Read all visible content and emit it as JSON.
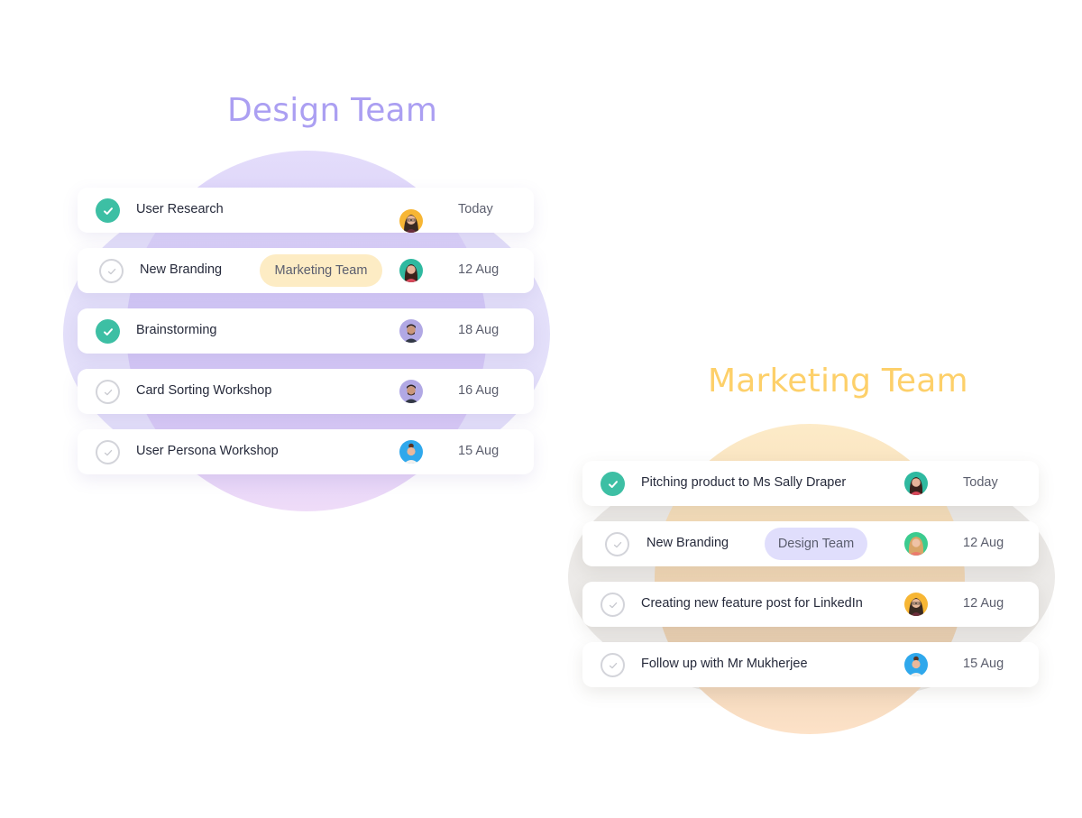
{
  "colors": {
    "design_accent": "#ab9ff2",
    "marketing_accent": "#fdd06a",
    "check_done": "#3dbfa4",
    "check_todo_border": "#d3d4da",
    "tag_marketing_bg": "#fdecc4",
    "tag_design_bg": "#e0defc"
  },
  "design_team": {
    "title": "Design Team",
    "tasks": [
      {
        "name": "User Research",
        "done": true,
        "tag": null,
        "avatar": "avatar-woman-glasses-yellow",
        "due": "Today"
      },
      {
        "name": "New Branding",
        "done": false,
        "tag": "Marketing Team",
        "avatar": "avatar-woman-teal",
        "due": "12 Aug"
      },
      {
        "name": "Brainstorming",
        "done": true,
        "tag": null,
        "avatar": "avatar-man-beard-lavender",
        "due": "18 Aug"
      },
      {
        "name": "Card Sorting Workshop",
        "done": false,
        "tag": null,
        "avatar": "avatar-man-beard-lavender",
        "due": "16 Aug"
      },
      {
        "name": "User Persona Workshop",
        "done": false,
        "tag": null,
        "avatar": "avatar-woman-blue",
        "due": "15 Aug"
      }
    ]
  },
  "marketing_team": {
    "title": "Marketing Team",
    "tasks": [
      {
        "name": "Pitching product to Ms Sally Draper",
        "done": true,
        "tag": null,
        "avatar": "avatar-woman-teal",
        "due": "Today"
      },
      {
        "name": "New Branding",
        "done": false,
        "tag": "Design Team",
        "avatar": "avatar-woman-blonde-green",
        "due": "12 Aug"
      },
      {
        "name": "Creating new feature post for LinkedIn",
        "done": false,
        "tag": null,
        "avatar": "avatar-woman-glasses-yellow",
        "due": "12 Aug"
      },
      {
        "name": "Follow up with Mr Mukherjee",
        "done": false,
        "tag": null,
        "avatar": "avatar-woman-blue",
        "due": "15 Aug"
      }
    ]
  }
}
